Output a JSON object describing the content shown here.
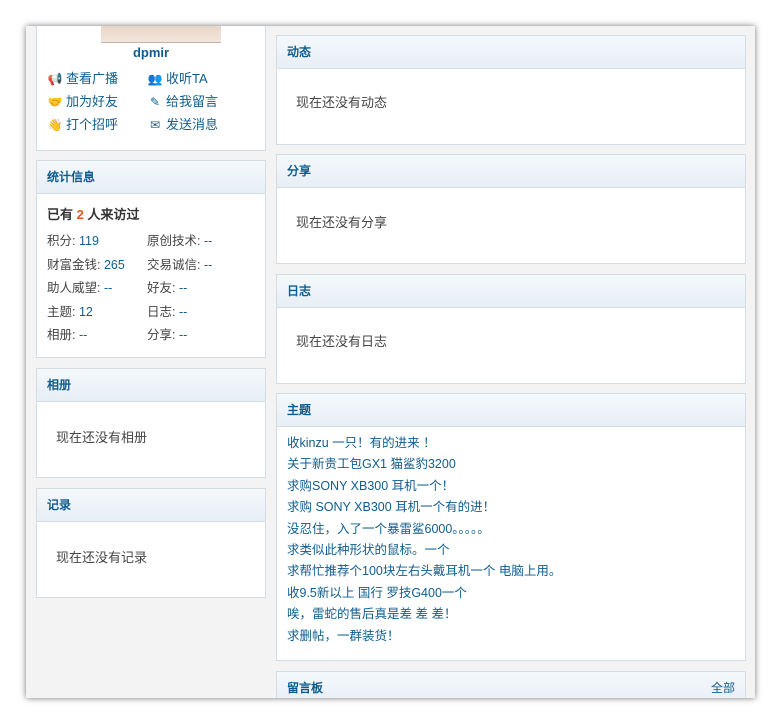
{
  "profile": {
    "username": "dpmir",
    "actions": [
      {
        "label": "查看广播",
        "icon": "megaphone-icon"
      },
      {
        "label": "收听TA",
        "icon": "listen-people-icon"
      },
      {
        "label": "加为好友",
        "icon": "handshake-icon"
      },
      {
        "label": "给我留言",
        "icon": "pencil-icon"
      },
      {
        "label": "打个招呼",
        "icon": "wave-people-icon"
      },
      {
        "label": "发送消息",
        "icon": "envelope-icon"
      }
    ]
  },
  "stats": {
    "title": "统计信息",
    "visitors_prefix": "已有",
    "visitors_count": "2",
    "visitors_suffix": "人来访过",
    "items": [
      {
        "label": "积分:",
        "value": "119"
      },
      {
        "label": "原创技术:",
        "value": "--"
      },
      {
        "label": "财富金钱:",
        "value": "265"
      },
      {
        "label": "交易诚信:",
        "value": "--"
      },
      {
        "label": "助人威望:",
        "value": "--"
      },
      {
        "label": "好友:",
        "value": "--"
      },
      {
        "label": "主题:",
        "value": "12"
      },
      {
        "label": "日志:",
        "value": "--"
      },
      {
        "label": "相册:",
        "value": "--"
      },
      {
        "label": "分享:",
        "value": "--"
      }
    ]
  },
  "album": {
    "title": "相册",
    "empty_text": "现在还没有相册"
  },
  "records": {
    "title": "记录",
    "empty_text": "现在还没有记录"
  },
  "feed": {
    "title": "动态",
    "empty_text": "现在还没有动态"
  },
  "share": {
    "title": "分享",
    "empty_text": "现在还没有分享"
  },
  "blog": {
    "title": "日志",
    "empty_text": "现在还没有日志"
  },
  "topics": {
    "title": "主题",
    "items": [
      "收kinzu 一只！有的进来 ！",
      "关于新贵工包GX1 猫鲨豹3200",
      "求购SONY XB300 耳机一个！",
      "求购 SONY XB300 耳机一个有的进！",
      "没忍住，入了一个暴雷鲨6000。。。。。",
      "求类似此种形状的鼠标。一个",
      "求帮忙推荐个100块左右头戴耳机一个 电脑上用。",
      "收9.5新以上 国行 罗技G400一个",
      "唉，雷蛇的售后真是差 差 差！",
      "求删帖，一群装货！"
    ]
  },
  "guestbook": {
    "title": "留言板",
    "all_link": "全部"
  }
}
